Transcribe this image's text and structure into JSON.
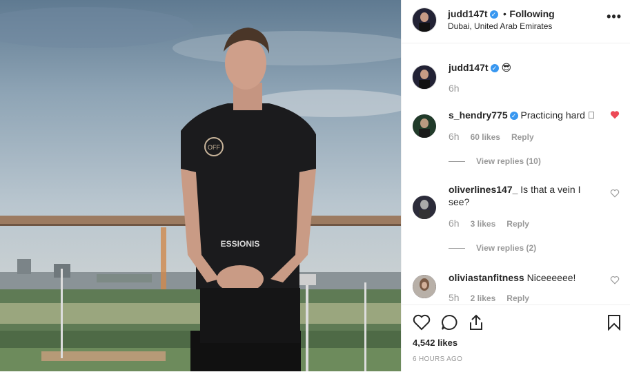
{
  "post": {
    "author": "judd147t",
    "separator": "•",
    "follow_status": "Following",
    "location": "Dubai, United Arab Emirates",
    "more_options": "•••",
    "caption": {
      "username": "judd147t",
      "text": "😎",
      "time": "6h"
    }
  },
  "comments": [
    {
      "username": "s_hendry775",
      "verified": true,
      "text": "Practicing hard 🏻",
      "time": "6h",
      "likes": "60 likes",
      "reply": "Reply",
      "liked": true,
      "view_replies": "View replies (10)"
    },
    {
      "username": "oliverlines147_",
      "verified": false,
      "text": "Is that a vein I see?",
      "time": "6h",
      "likes": "3 likes",
      "reply": "Reply",
      "liked": false,
      "view_replies": "View replies (2)"
    },
    {
      "username": "oliviastanfitness",
      "verified": false,
      "text": "Niceeeeee!",
      "time": "5h",
      "likes": "2 likes",
      "reply": "Reply",
      "liked": false
    }
  ],
  "footer": {
    "likes": "4,542 likes",
    "time_ago": "6 HOURS AGO"
  },
  "photo": {
    "shirt_text_logo": "OFF",
    "shirt_text_band": "ESSIONIS"
  },
  "colors": {
    "verified": "#3897f0",
    "liked_heart": "#ed4956",
    "secondary_text": "#999999"
  }
}
